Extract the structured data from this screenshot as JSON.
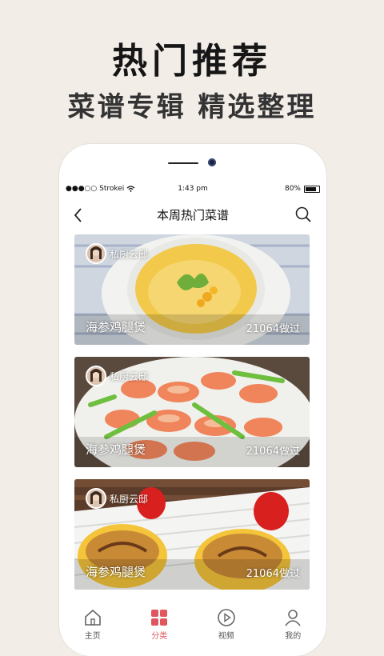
{
  "promo": {
    "headline": "热门推荐",
    "subline": "菜谱专辑 精选整理"
  },
  "status_bar": {
    "carrier": "●●●○○ Strokei",
    "time": "1:43 pm",
    "battery_text": "80%",
    "battery_level": 0.8
  },
  "nav": {
    "title": "本周热门菜谱"
  },
  "cards": [
    {
      "author": "私厨云邸",
      "recipe": "海参鸡腿煲",
      "count": "21064做过"
    },
    {
      "author": "私厨云邸",
      "recipe": "海参鸡腿煲",
      "count": "21064做过"
    },
    {
      "author": "私厨云邸",
      "recipe": "海参鸡腿煲",
      "count": "21064做过"
    }
  ],
  "tabs": [
    {
      "label": "主页",
      "icon": "home-icon"
    },
    {
      "label": "分类",
      "icon": "category-grid-icon"
    },
    {
      "label": "视频",
      "icon": "play-circle-icon"
    },
    {
      "label": "我的",
      "icon": "user-icon"
    }
  ],
  "colors": {
    "background": "#f3ede8",
    "accent": "#e0565f"
  }
}
